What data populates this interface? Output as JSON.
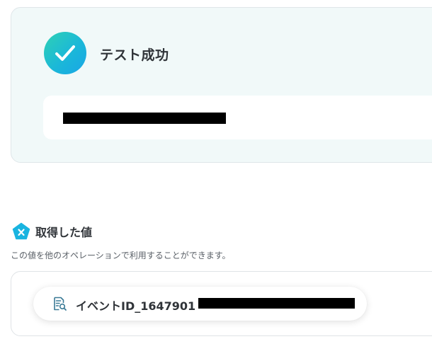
{
  "success": {
    "title": "テスト成功"
  },
  "section": {
    "title": "取得した値",
    "description": "この値を他のオペレーションで利用することができます。"
  },
  "values": [
    {
      "label": "イベントID_1647901"
    }
  ],
  "icons": {
    "status": "check-icon",
    "section": "x-pentagon-icon",
    "value": "document-search-icon"
  },
  "colors": {
    "success_gradient_start": "#2fd1b4",
    "success_gradient_end": "#19a6e6",
    "section_icon": "#19b4e0",
    "panel_background": "#f1f9f9",
    "value_icon": "#3a7a96"
  }
}
